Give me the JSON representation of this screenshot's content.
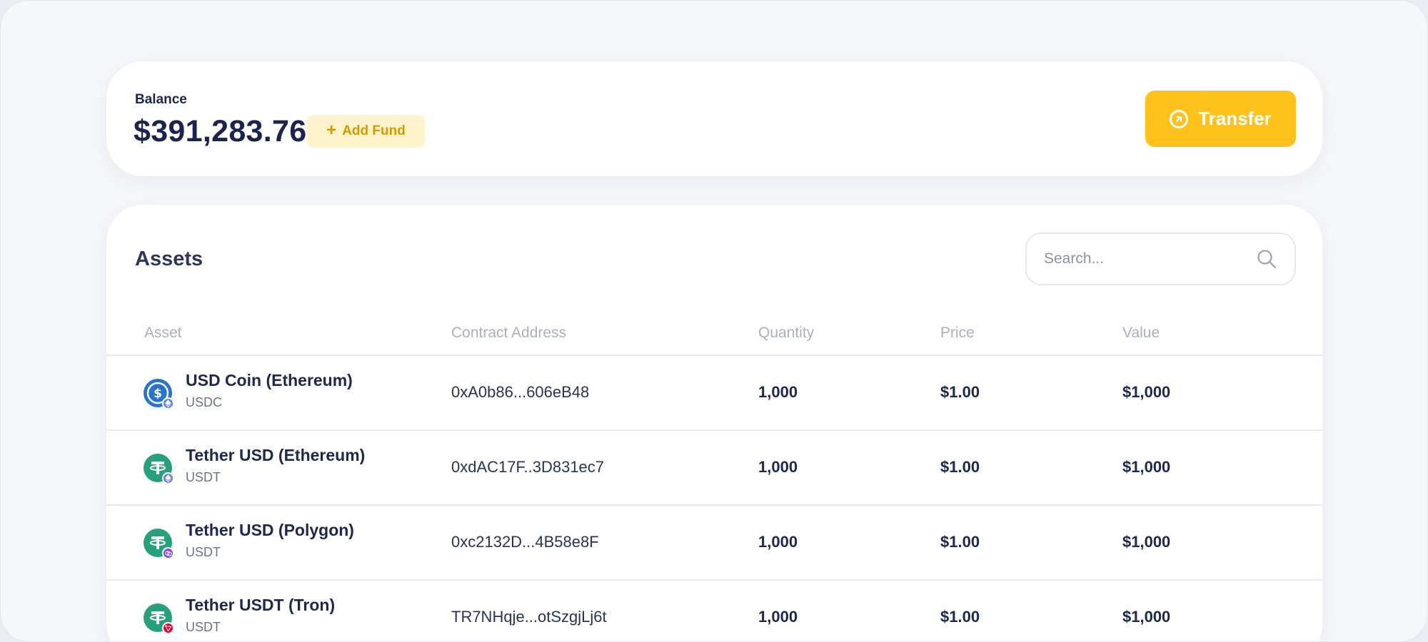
{
  "balance": {
    "label": "Balance",
    "amount": "$391,283.76",
    "add_fund_label": "Add Fund",
    "transfer_label": "Transfer"
  },
  "assets": {
    "title": "Assets",
    "search_placeholder": "Search...",
    "columns": {
      "asset": "Asset",
      "contract": "Contract Address",
      "quantity": "Quantity",
      "price": "Price",
      "value": "Value"
    },
    "rows": [
      {
        "name": "USD Coin (Ethereum)",
        "symbol": "USDC",
        "address": "0xA0b86...606eB48",
        "quantity": "1,000",
        "price": "$1.00",
        "value": "$1,000",
        "icon": "usdc-icon",
        "network_icon": "ethereum-icon"
      },
      {
        "name": "Tether USD (Ethereum)",
        "symbol": "USDT",
        "address": "0xdAC17F..3D831ec7",
        "quantity": "1,000",
        "price": "$1.00",
        "value": "$1,000",
        "icon": "tether-icon",
        "network_icon": "ethereum-icon"
      },
      {
        "name": "Tether USD (Polygon)",
        "symbol": "USDT",
        "address": "0xc2132D...4B58e8F",
        "quantity": "1,000",
        "price": "$1.00",
        "value": "$1,000",
        "icon": "tether-icon",
        "network_icon": "polygon-icon"
      },
      {
        "name": "Tether USDT (Tron)",
        "symbol": "USDT",
        "address": "TR7NHqje...otSzgjLj6t",
        "quantity": "1,000",
        "price": "$1.00",
        "value": "$1,000",
        "icon": "tether-icon",
        "network_icon": "tron-icon"
      }
    ]
  },
  "colors": {
    "accent": "#ffc11c",
    "accent_soft": "#fff3cc",
    "text_primary": "#1d2751",
    "text_muted": "#a7afc1",
    "usdc": "#2775ca",
    "tether": "#26a17b",
    "ethereum": "#627eea",
    "polygon": "#8247e5",
    "tron": "#eb0029"
  }
}
